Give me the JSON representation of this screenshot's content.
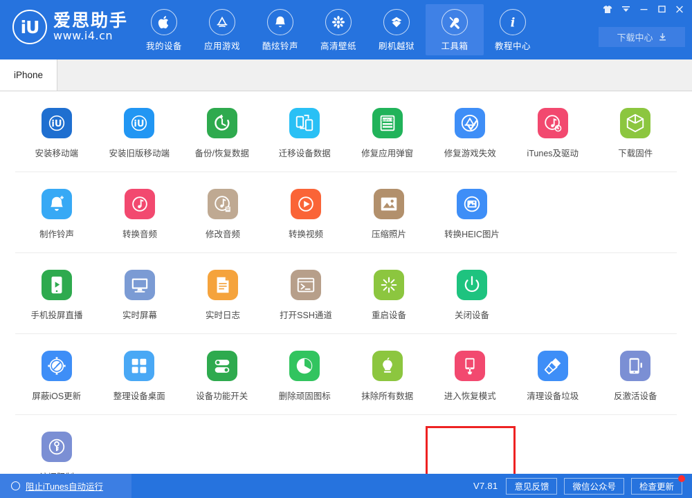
{
  "app": {
    "logo_initials": "iU",
    "logo_cn": "爱思助手",
    "logo_url": "www.i4.cn"
  },
  "header": {
    "nav": [
      {
        "label": "我的设备",
        "icon": "apple-icon",
        "active": false
      },
      {
        "label": "应用游戏",
        "icon": "appstore-icon",
        "active": false
      },
      {
        "label": "酷炫铃声",
        "icon": "bell-icon",
        "active": false
      },
      {
        "label": "高清壁纸",
        "icon": "flower-icon",
        "active": false
      },
      {
        "label": "刷机越狱",
        "icon": "box-open-icon",
        "active": false
      },
      {
        "label": "工具箱",
        "icon": "tools-icon",
        "active": true
      },
      {
        "label": "教程中心",
        "icon": "info-icon",
        "active": false
      }
    ],
    "download_center": "下载中心",
    "window_controls": [
      {
        "name": "skin-icon",
        "glyph": "👕"
      },
      {
        "name": "chevron-down-icon",
        "glyph": "▾"
      },
      {
        "name": "minimize-icon",
        "glyph": "–"
      },
      {
        "name": "maximize-icon",
        "glyph": "□"
      },
      {
        "name": "close-icon",
        "glyph": "✕"
      }
    ]
  },
  "tabs": [
    {
      "label": "iPhone",
      "active": true
    }
  ],
  "toolbox": {
    "rows": [
      [
        {
          "label": "安装移动端",
          "icon": "i4-assistant-icon",
          "bg": "#1f6fd0",
          "fg": "#ffffff"
        },
        {
          "label": "安装旧版移动端",
          "icon": "i4-assistant-old-icon",
          "bg": "#2196f3",
          "fg": "#ffffff"
        },
        {
          "label": "备份/恢复数据",
          "icon": "backup-restore-icon",
          "bg": "#2eaa4e",
          "fg": "#ffffff"
        },
        {
          "label": "迁移设备数据",
          "icon": "migrate-device-icon",
          "bg": "#29c0f5",
          "fg": "#ffffff"
        },
        {
          "label": "修复应用弹窗",
          "icon": "appleid-card-icon",
          "bg": "#21b35a",
          "fg": "#ffffff"
        },
        {
          "label": "修复游戏失效",
          "icon": "appstore-fix-icon",
          "bg": "#3e8ef7",
          "fg": "#ffffff"
        },
        {
          "label": "iTunes及驱动",
          "icon": "itunes-driver-icon",
          "bg": "#f2496f",
          "fg": "#ffffff"
        },
        {
          "label": "下载固件",
          "icon": "firmware-cube-icon",
          "bg": "#8cc63f",
          "fg": "#ffffff"
        }
      ],
      [
        {
          "label": "制作铃声",
          "icon": "ringtone-make-icon",
          "bg": "#37a9f5",
          "fg": "#ffffff"
        },
        {
          "label": "转换音频",
          "icon": "audio-convert-icon",
          "bg": "#f2496f",
          "fg": "#ffffff"
        },
        {
          "label": "修改音频",
          "icon": "audio-edit-icon",
          "bg": "#bfa992",
          "fg": "#ffffff"
        },
        {
          "label": "转换视频",
          "icon": "video-convert-icon",
          "bg": "#fa6437",
          "fg": "#ffffff"
        },
        {
          "label": "压缩照片",
          "icon": "photo-compress-icon",
          "bg": "#b2906c",
          "fg": "#ffffff"
        },
        {
          "label": "转换HEIC图片",
          "icon": "heic-convert-icon",
          "bg": "#3e8ef7",
          "fg": "#ffffff"
        }
      ],
      [
        {
          "label": "手机投屏直播",
          "icon": "screen-cast-icon",
          "bg": "#2eaa4e",
          "fg": "#ffffff"
        },
        {
          "label": "实时屏幕",
          "icon": "live-screen-icon",
          "bg": "#7b9bd4",
          "fg": "#ffffff"
        },
        {
          "label": "实时日志",
          "icon": "live-log-icon",
          "bg": "#f5a33c",
          "fg": "#ffffff"
        },
        {
          "label": "打开SSH通道",
          "icon": "ssh-terminal-icon",
          "bg": "#b79f8a",
          "fg": "#ffffff"
        },
        {
          "label": "重启设备",
          "icon": "restart-device-icon",
          "bg": "#8cc63f",
          "fg": "#ffffff"
        },
        {
          "label": "关闭设备",
          "icon": "power-off-icon",
          "bg": "#1ec37f",
          "fg": "#ffffff"
        }
      ],
      [
        {
          "label": "屏蔽iOS更新",
          "icon": "block-ios-update-icon",
          "bg": "#3e8ef7",
          "fg": "#ffffff"
        },
        {
          "label": "整理设备桌面",
          "icon": "arrange-desktop-icon",
          "bg": "#49a8f5",
          "fg": "#ffffff"
        },
        {
          "label": "设备功能开关",
          "icon": "feature-toggle-icon",
          "bg": "#2eaa4e",
          "fg": "#ffffff"
        },
        {
          "label": "删除顽固图标",
          "icon": "delete-icon-icon",
          "bg": "#32c45f",
          "fg": "#ffffff"
        },
        {
          "label": "抹除所有数据",
          "icon": "erase-all-data-icon",
          "bg": "#8cc63f",
          "fg": "#ffffff"
        },
        {
          "label": "进入恢复模式",
          "icon": "recovery-mode-icon",
          "bg": "#f2496f",
          "fg": "#ffffff",
          "highlighted": true
        },
        {
          "label": "清理设备垃圾",
          "icon": "clean-junk-icon",
          "bg": "#3e8ef7",
          "fg": "#ffffff"
        },
        {
          "label": "反激活设备",
          "icon": "deactivate-device-icon",
          "bg": "#7b8fd4",
          "fg": "#ffffff"
        }
      ],
      [
        {
          "label": "访问限制",
          "icon": "access-restriction-icon",
          "bg": "#7b8fd4",
          "fg": "#ffffff"
        }
      ]
    ]
  },
  "status_bar": {
    "block_itunes_label": "阻止iTunes自动运行",
    "version": "V7.81",
    "buttons": [
      {
        "label": "意见反馈",
        "badge": false
      },
      {
        "label": "微信公众号",
        "badge": false
      },
      {
        "label": "检查更新",
        "badge": true
      }
    ]
  },
  "colors": {
    "brand_blue": "#2673de",
    "brand_blue_light": "#3c7ee3",
    "highlight_red": "#ee2222"
  }
}
